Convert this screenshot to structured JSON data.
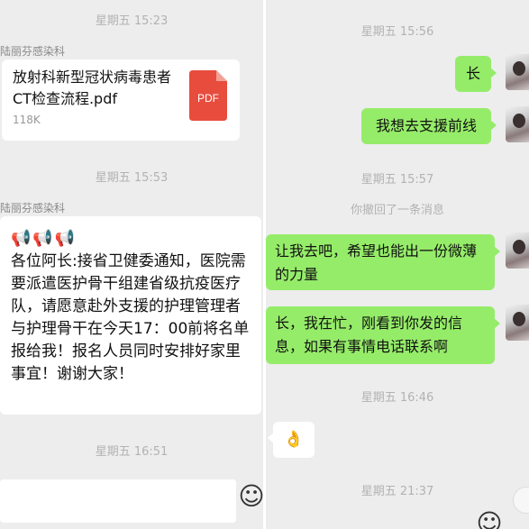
{
  "left": {
    "time1": "星期五 15:23",
    "sender1": "陆丽芬感染科",
    "file": {
      "name": "放射科新型冠状病毒患者CT检查流程.pdf",
      "size": "118K",
      "icon_label": "PDF",
      "icon_color": "#e84c3d"
    },
    "time2": "星期五 15:53",
    "sender2": "陆丽芬感染科",
    "notice": {
      "emoji": "📢📢📢",
      "text": "各位阿长:接省卫健委通知，医院需要派遣医护骨干组建省级抗疫医疗队，请愿意赴外支援的护理管理者与护理骨干在今天17：00前将名单报给我！报名人员同时安排好家里事宜！谢谢大家！"
    },
    "time3": "星期五 16:51",
    "emoji_button": "☺"
  },
  "right": {
    "time1": "星期五 15:56",
    "msg1": "长",
    "msg2": "我想去支援前线",
    "time2": "星期五 15:57",
    "recall": "你撤回了一条消息",
    "msg3": "让我去吧，希望也能出一份微薄的力量",
    "msg4": "长，我在忙，刚看到你发的信息，如果有事情电话联系啊",
    "time3": "星期五 16:46",
    "ok_emoji": "👌",
    "time4": "星期五 21:37",
    "emoji_button": "☺"
  },
  "colors": {
    "chat_bg": "#ededed",
    "bubble_green": "#95ec69",
    "bubble_white": "#ffffff",
    "timestamp": "#b2b2b2"
  }
}
